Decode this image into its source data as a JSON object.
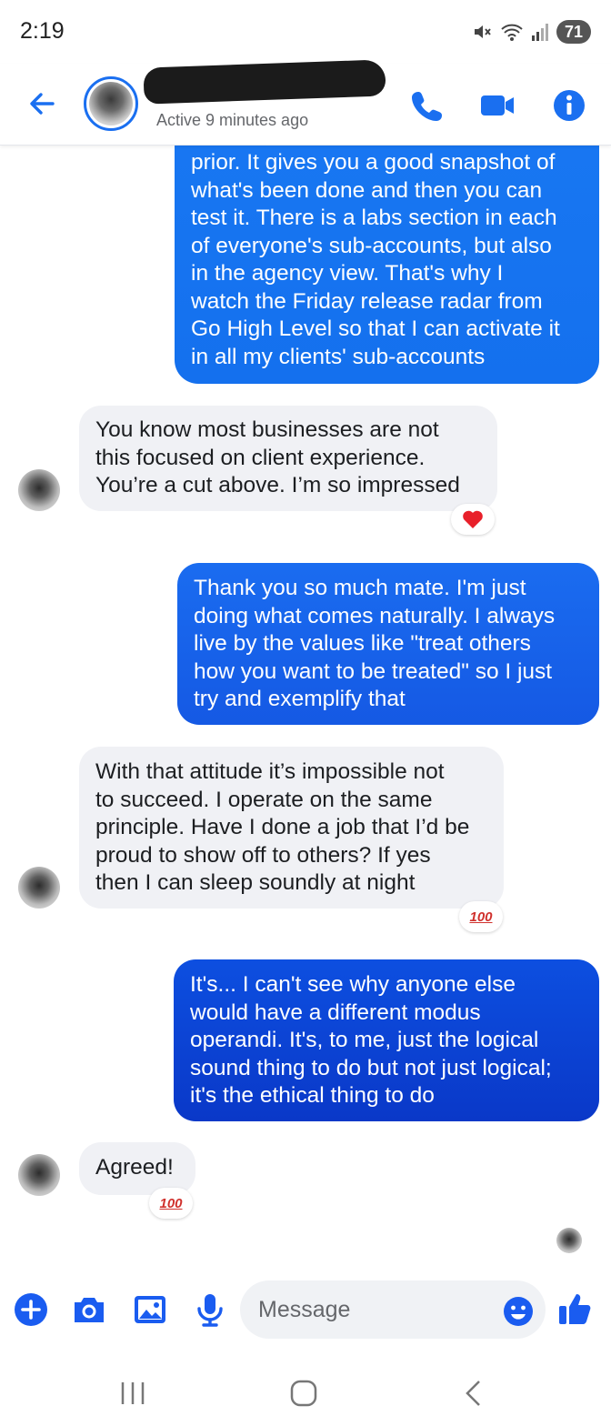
{
  "status_bar": {
    "time": "2:19",
    "battery": "71"
  },
  "header": {
    "active_status": "Active 9 minutes ago"
  },
  "messages": [
    {
      "direction": "out",
      "lines": [
        "prior. It gives you a good snapshot of",
        "what's been done and then you can",
        "test it. There is a labs section in each",
        "of everyone's sub-accounts, but also",
        "in the agency view. That's why I",
        "watch the Friday release radar from",
        "Go High Level so that I can activate it",
        "in all my clients' sub-accounts"
      ]
    },
    {
      "direction": "in",
      "lines": [
        "You know most businesses are not",
        "this focused on client experience.",
        "You’re a cut above. I’m so impressed"
      ],
      "reaction": "heart"
    },
    {
      "direction": "out",
      "lines": [
        "Thank you so much mate. I'm just",
        "doing what comes naturally. I always",
        "live by the values like \"treat others",
        "how you want to be treated\" so I just",
        "try and exemplify that"
      ]
    },
    {
      "direction": "in",
      "lines": [
        "With that attitude it’s impossible not",
        "to succeed. I operate on the same",
        "principle. Have I done a job that I’d be",
        "proud to show off to others? If yes",
        "then I can sleep soundly at night"
      ],
      "reaction": "100"
    },
    {
      "direction": "out",
      "lines": [
        "It's... I can't see why anyone else",
        "would have a different modus",
        "operandi. It's, to me, just the logical",
        "sound thing to do but not just logical;",
        "it's the ethical thing to do"
      ]
    },
    {
      "direction": "in",
      "lines": [
        "Agreed!"
      ],
      "reaction": "100"
    }
  ],
  "reactions": {
    "hundred": "100"
  },
  "composer": {
    "placeholder": "Message"
  },
  "colors": {
    "accent": "#1a6ff0",
    "bubble_out_top": "#1877f2",
    "bubble_out_bottom": "#0a3ccf",
    "bubble_in": "#f0f1f5"
  },
  "icons": [
    "back-arrow-icon",
    "phone-icon",
    "video-icon",
    "info-icon",
    "plus-icon",
    "camera-icon",
    "image-icon",
    "microphone-icon",
    "emoji-icon",
    "thumbs-up-icon",
    "heart-icon",
    "hundred-emoji-icon",
    "recent-apps-icon",
    "home-icon",
    "back-nav-icon"
  ]
}
